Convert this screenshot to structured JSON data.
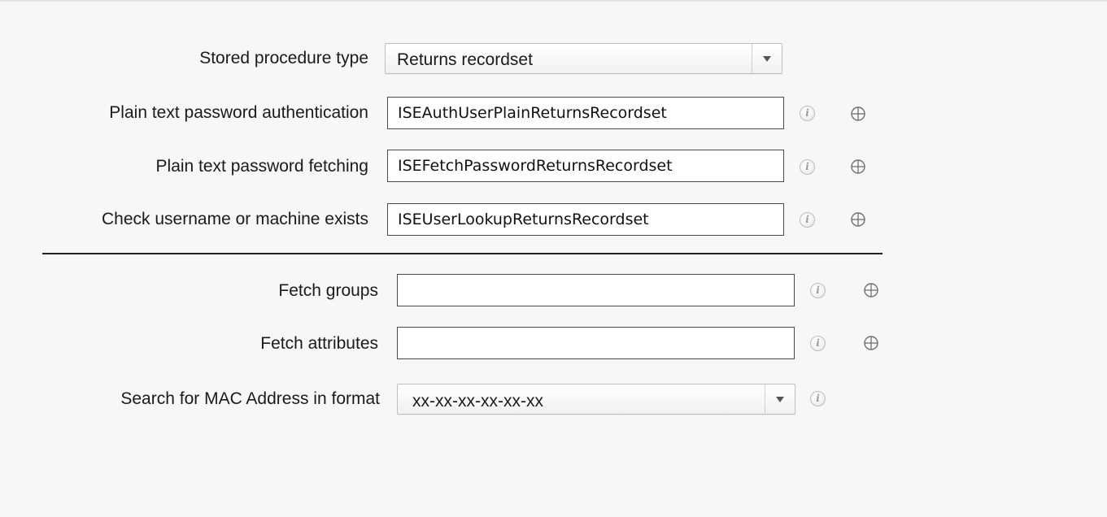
{
  "form": {
    "stored_procedure_type": {
      "label": "Stored procedure type",
      "value": "Returns recordset"
    },
    "plain_auth": {
      "label": "Plain text password authentication",
      "value": "ISEAuthUserPlainReturnsRecordset"
    },
    "plain_fetch": {
      "label": "Plain text password fetching",
      "value": "ISEFetchPasswordReturnsRecordset"
    },
    "check_user": {
      "label": "Check username or machine exists",
      "value": "ISEUserLookupReturnsRecordset"
    },
    "fetch_groups": {
      "label": "Fetch groups",
      "value": ""
    },
    "fetch_attributes": {
      "label": "Fetch attributes",
      "value": ""
    },
    "mac_format": {
      "label": "Search for MAC Address in format",
      "value": "xx-xx-xx-xx-xx-xx"
    }
  },
  "icons": {
    "info": "info-icon",
    "info_glyph": "i",
    "target": "crosshair-icon"
  },
  "colors": {
    "background": "#f7f7f7",
    "textbox_border": "#4a4a4a",
    "divider": "#222222"
  }
}
